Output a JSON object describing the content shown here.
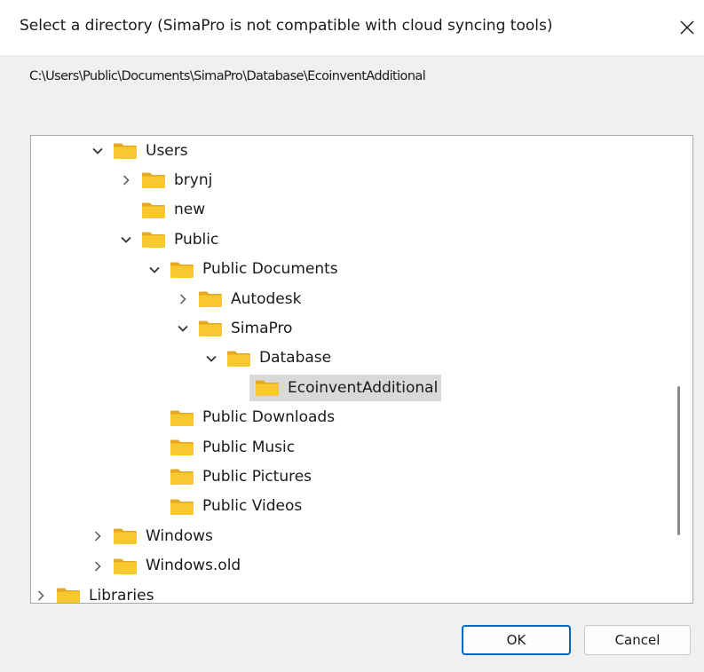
{
  "window": {
    "title": "Select a directory (SimaPro is not compatible with cloud syncing tools)",
    "close_glyph": "✕"
  },
  "path": "C:\\Users\\Public\\Documents\\SimaPro\\Database\\EcoinventAdditional",
  "tree": {
    "items": [
      {
        "label": "Users",
        "state": "expanded",
        "depth": 0
      },
      {
        "label": "brynj",
        "state": "collapsed",
        "depth": 1
      },
      {
        "label": "new",
        "state": "leaf",
        "depth": 1
      },
      {
        "label": "Public",
        "state": "expanded",
        "depth": 1
      },
      {
        "label": "Public Documents",
        "state": "expanded",
        "depth": 2
      },
      {
        "label": "Autodesk",
        "state": "collapsed",
        "depth": 3
      },
      {
        "label": "SimaPro",
        "state": "expanded",
        "depth": 3
      },
      {
        "label": "Database",
        "state": "expanded",
        "depth": 4
      },
      {
        "label": "EcoinventAdditional",
        "state": "leaf",
        "depth": 5,
        "selected": true
      },
      {
        "label": "Public Downloads",
        "state": "leaf",
        "depth": 2
      },
      {
        "label": "Public Music",
        "state": "leaf",
        "depth": 2
      },
      {
        "label": "Public Pictures",
        "state": "leaf",
        "depth": 2
      },
      {
        "label": "Public Videos",
        "state": "leaf",
        "depth": 2
      },
      {
        "label": "Windows",
        "state": "collapsed",
        "depth": 0
      },
      {
        "label": "Windows.old",
        "state": "collapsed",
        "depth": 0
      },
      {
        "label": "Libraries",
        "state": "collapsed",
        "depth": -2
      }
    ]
  },
  "buttons": {
    "ok_label": "OK",
    "cancel_label": "Cancel"
  },
  "colors": {
    "accent": "#0067c0",
    "selection": "#d9d9d9",
    "folder_body": "#f8c82f",
    "folder_tab": "#e5a823"
  },
  "icons": {
    "expanded": "chevron-down-icon",
    "collapsed": "chevron-right-icon",
    "folder": "folder-icon",
    "close": "close-icon"
  }
}
